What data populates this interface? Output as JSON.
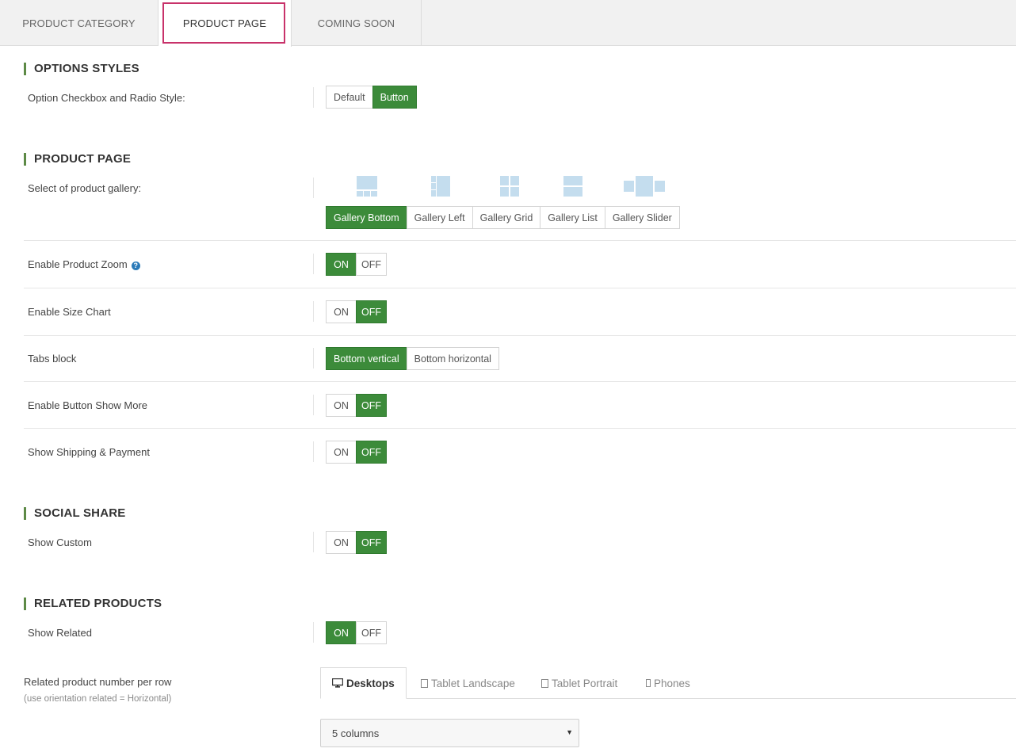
{
  "top_tabs": [
    {
      "label": "PRODUCT CATEGORY",
      "active": false
    },
    {
      "label": "PRODUCT PAGE",
      "active": true
    },
    {
      "label": "COMING SOON",
      "active": false
    }
  ],
  "colors": {
    "accent": "#3c8b3a",
    "section_bar": "#5d8a46",
    "active_tab_outline": "#c8326a",
    "gallery_icon": "#c4ddee"
  },
  "sections": {
    "options_styles": {
      "title": "OPTIONS STYLES",
      "checkbox_style": {
        "label": "Option Checkbox and Radio Style:",
        "options": [
          "Default",
          "Button"
        ],
        "selected": "Button"
      }
    },
    "product_page": {
      "title": "PRODUCT PAGE",
      "gallery": {
        "label": "Select of product gallery:",
        "options": [
          "Gallery Bottom",
          "Gallery Left",
          "Gallery Grid",
          "Gallery List",
          "Gallery Slider"
        ],
        "icons": [
          "gallery-bottom-icon",
          "gallery-left-icon",
          "gallery-grid-icon",
          "gallery-list-icon",
          "gallery-slider-icon"
        ],
        "selected": "Gallery Bottom"
      },
      "zoom": {
        "label": "Enable Product Zoom",
        "help_icon": "question-circle-icon",
        "on": "ON",
        "off": "OFF",
        "value": "ON"
      },
      "size_chart": {
        "label": "Enable Size Chart",
        "on": "ON",
        "off": "OFF",
        "value": "OFF"
      },
      "tabs_block": {
        "label": "Tabs block",
        "options": [
          "Bottom vertical",
          "Bottom horizontal"
        ],
        "selected": "Bottom vertical"
      },
      "show_more": {
        "label": "Enable Button Show More",
        "on": "ON",
        "off": "OFF",
        "value": "OFF"
      },
      "shipping": {
        "label": "Show Shipping & Payment",
        "on": "ON",
        "off": "OFF",
        "value": "OFF"
      }
    },
    "social_share": {
      "title": "SOCIAL SHARE",
      "show_custom": {
        "label": "Show Custom",
        "on": "ON",
        "off": "OFF",
        "value": "OFF"
      }
    },
    "related_products": {
      "title": "RELATED PRODUCTS",
      "show_related": {
        "label": "Show Related",
        "on": "ON",
        "off": "OFF",
        "value": "ON"
      },
      "per_row": {
        "label": "Related product number per row",
        "sublabel": "(use orientation related = Horizontal)",
        "device_tabs": [
          {
            "label": "Desktops",
            "icon": "desktop-icon",
            "active": true
          },
          {
            "label": "Tablet Landscape",
            "icon": "tablet-landscape-icon",
            "active": false
          },
          {
            "label": "Tablet Portrait",
            "icon": "tablet-portrait-icon",
            "active": false
          },
          {
            "label": "Phones",
            "icon": "phone-icon",
            "active": false
          }
        ],
        "select_value": "5 columns"
      }
    }
  }
}
